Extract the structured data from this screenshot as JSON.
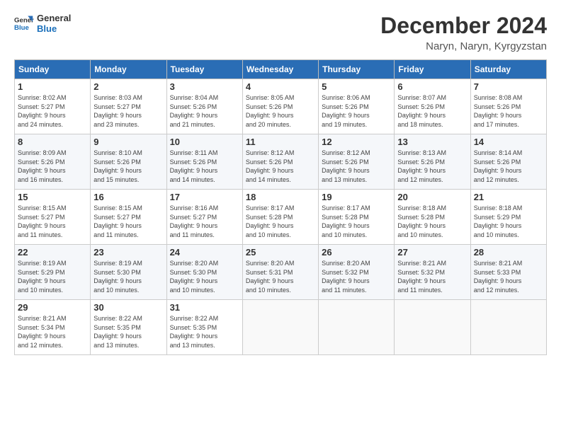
{
  "logo": {
    "line1": "General",
    "line2": "Blue"
  },
  "title": "December 2024",
  "location": "Naryn, Naryn, Kyrgyzstan",
  "weekdays": [
    "Sunday",
    "Monday",
    "Tuesday",
    "Wednesday",
    "Thursday",
    "Friday",
    "Saturday"
  ],
  "weeks": [
    [
      {
        "day": "1",
        "info": "Sunrise: 8:02 AM\nSunset: 5:27 PM\nDaylight: 9 hours\nand 24 minutes."
      },
      {
        "day": "2",
        "info": "Sunrise: 8:03 AM\nSunset: 5:27 PM\nDaylight: 9 hours\nand 23 minutes."
      },
      {
        "day": "3",
        "info": "Sunrise: 8:04 AM\nSunset: 5:26 PM\nDaylight: 9 hours\nand 21 minutes."
      },
      {
        "day": "4",
        "info": "Sunrise: 8:05 AM\nSunset: 5:26 PM\nDaylight: 9 hours\nand 20 minutes."
      },
      {
        "day": "5",
        "info": "Sunrise: 8:06 AM\nSunset: 5:26 PM\nDaylight: 9 hours\nand 19 minutes."
      },
      {
        "day": "6",
        "info": "Sunrise: 8:07 AM\nSunset: 5:26 PM\nDaylight: 9 hours\nand 18 minutes."
      },
      {
        "day": "7",
        "info": "Sunrise: 8:08 AM\nSunset: 5:26 PM\nDaylight: 9 hours\nand 17 minutes."
      }
    ],
    [
      {
        "day": "8",
        "info": "Sunrise: 8:09 AM\nSunset: 5:26 PM\nDaylight: 9 hours\nand 16 minutes."
      },
      {
        "day": "9",
        "info": "Sunrise: 8:10 AM\nSunset: 5:26 PM\nDaylight: 9 hours\nand 15 minutes."
      },
      {
        "day": "10",
        "info": "Sunrise: 8:11 AM\nSunset: 5:26 PM\nDaylight: 9 hours\nand 14 minutes."
      },
      {
        "day": "11",
        "info": "Sunrise: 8:12 AM\nSunset: 5:26 PM\nDaylight: 9 hours\nand 14 minutes."
      },
      {
        "day": "12",
        "info": "Sunrise: 8:12 AM\nSunset: 5:26 PM\nDaylight: 9 hours\nand 13 minutes."
      },
      {
        "day": "13",
        "info": "Sunrise: 8:13 AM\nSunset: 5:26 PM\nDaylight: 9 hours\nand 12 minutes."
      },
      {
        "day": "14",
        "info": "Sunrise: 8:14 AM\nSunset: 5:26 PM\nDaylight: 9 hours\nand 12 minutes."
      }
    ],
    [
      {
        "day": "15",
        "info": "Sunrise: 8:15 AM\nSunset: 5:27 PM\nDaylight: 9 hours\nand 11 minutes."
      },
      {
        "day": "16",
        "info": "Sunrise: 8:15 AM\nSunset: 5:27 PM\nDaylight: 9 hours\nand 11 minutes."
      },
      {
        "day": "17",
        "info": "Sunrise: 8:16 AM\nSunset: 5:27 PM\nDaylight: 9 hours\nand 11 minutes."
      },
      {
        "day": "18",
        "info": "Sunrise: 8:17 AM\nSunset: 5:28 PM\nDaylight: 9 hours\nand 10 minutes."
      },
      {
        "day": "19",
        "info": "Sunrise: 8:17 AM\nSunset: 5:28 PM\nDaylight: 9 hours\nand 10 minutes."
      },
      {
        "day": "20",
        "info": "Sunrise: 8:18 AM\nSunset: 5:28 PM\nDaylight: 9 hours\nand 10 minutes."
      },
      {
        "day": "21",
        "info": "Sunrise: 8:18 AM\nSunset: 5:29 PM\nDaylight: 9 hours\nand 10 minutes."
      }
    ],
    [
      {
        "day": "22",
        "info": "Sunrise: 8:19 AM\nSunset: 5:29 PM\nDaylight: 9 hours\nand 10 minutes."
      },
      {
        "day": "23",
        "info": "Sunrise: 8:19 AM\nSunset: 5:30 PM\nDaylight: 9 hours\nand 10 minutes."
      },
      {
        "day": "24",
        "info": "Sunrise: 8:20 AM\nSunset: 5:30 PM\nDaylight: 9 hours\nand 10 minutes."
      },
      {
        "day": "25",
        "info": "Sunrise: 8:20 AM\nSunset: 5:31 PM\nDaylight: 9 hours\nand 10 minutes."
      },
      {
        "day": "26",
        "info": "Sunrise: 8:20 AM\nSunset: 5:32 PM\nDaylight: 9 hours\nand 11 minutes."
      },
      {
        "day": "27",
        "info": "Sunrise: 8:21 AM\nSunset: 5:32 PM\nDaylight: 9 hours\nand 11 minutes."
      },
      {
        "day": "28",
        "info": "Sunrise: 8:21 AM\nSunset: 5:33 PM\nDaylight: 9 hours\nand 12 minutes."
      }
    ],
    [
      {
        "day": "29",
        "info": "Sunrise: 8:21 AM\nSunset: 5:34 PM\nDaylight: 9 hours\nand 12 minutes."
      },
      {
        "day": "30",
        "info": "Sunrise: 8:22 AM\nSunset: 5:35 PM\nDaylight: 9 hours\nand 13 minutes."
      },
      {
        "day": "31",
        "info": "Sunrise: 8:22 AM\nSunset: 5:35 PM\nDaylight: 9 hours\nand 13 minutes."
      },
      {
        "day": "",
        "info": ""
      },
      {
        "day": "",
        "info": ""
      },
      {
        "day": "",
        "info": ""
      },
      {
        "day": "",
        "info": ""
      }
    ]
  ]
}
